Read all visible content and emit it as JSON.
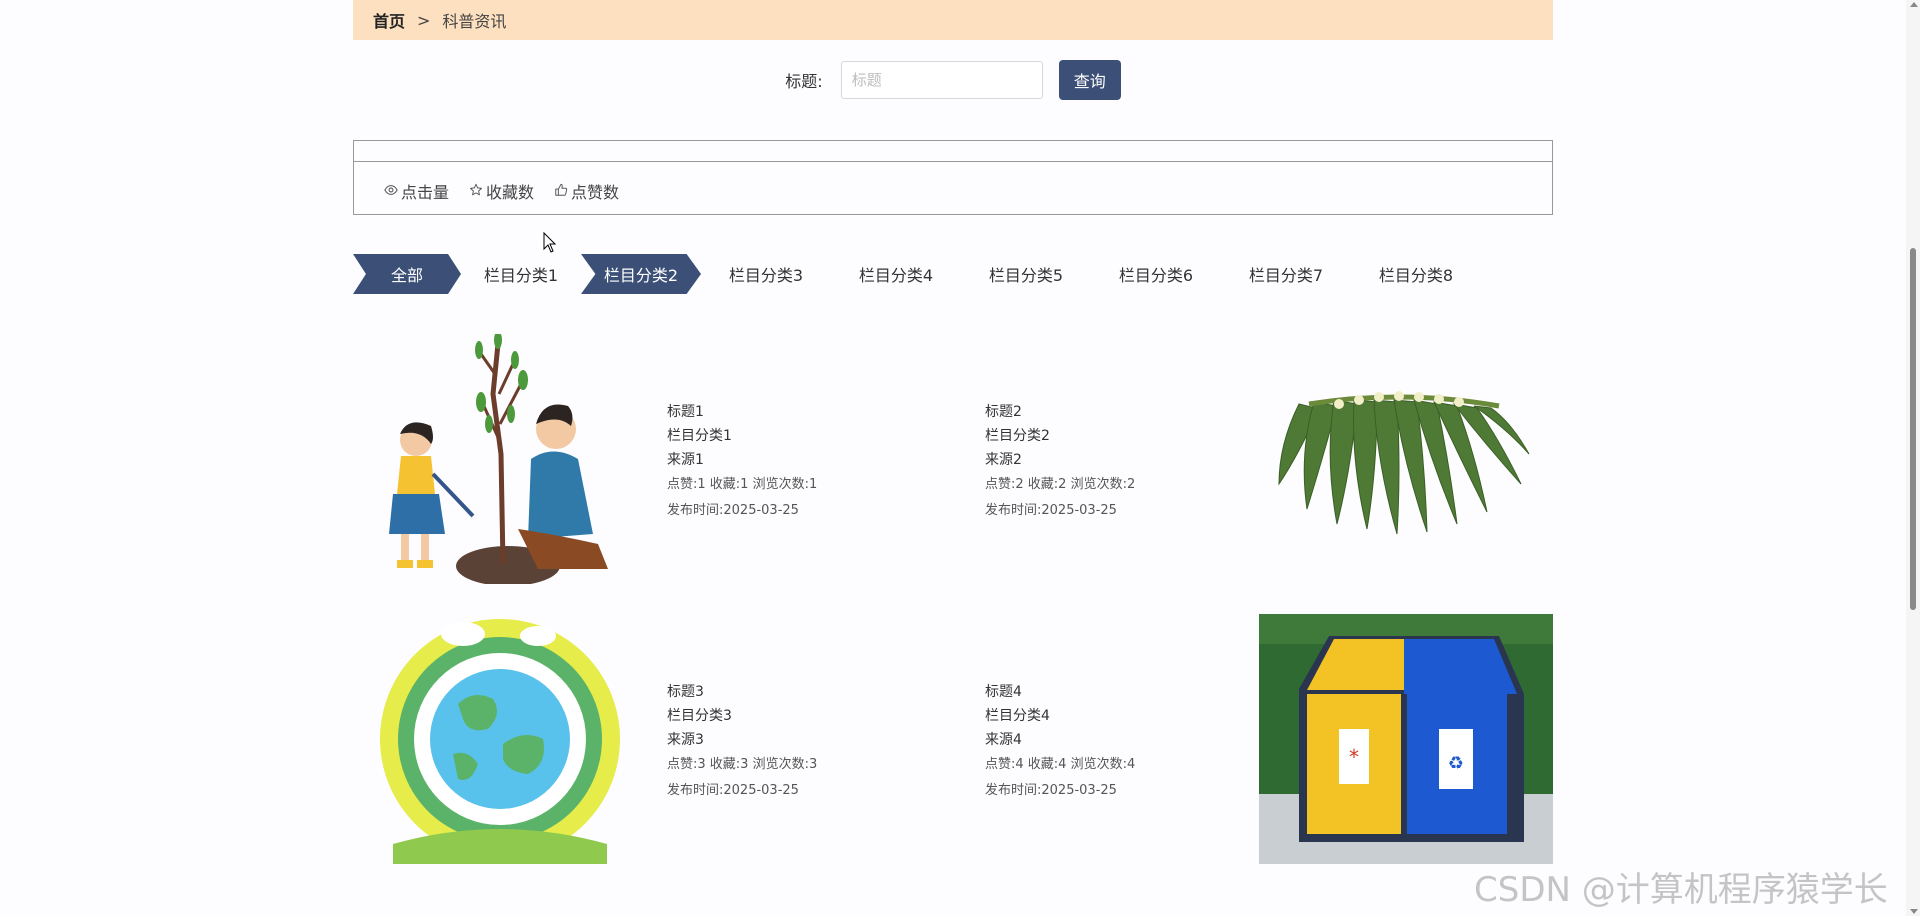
{
  "breadcrumb": {
    "home": "首页",
    "sep": ">",
    "current": "科普资讯"
  },
  "search": {
    "label": "标题:",
    "placeholder": "标题",
    "button": "查询"
  },
  "sorts": [
    "点击量",
    "收藏数",
    "点赞数"
  ],
  "tabs": [
    "全部",
    "栏目分类1",
    "栏目分类2",
    "栏目分类3",
    "栏目分类4",
    "栏目分类5",
    "栏目分类6",
    "栏目分类7",
    "栏目分类8"
  ],
  "active_tabs": [
    "全部",
    "栏目分类2"
  ],
  "articles": [
    {
      "title": "标题1",
      "category": "栏目分类1",
      "source": "来源1",
      "stats": "点赞:1  收藏:1  浏览次数:1",
      "date": "发布时间:2025-03-25",
      "image": "tree-planting-illustration"
    },
    {
      "title": "标题2",
      "category": "栏目分类2",
      "source": "来源2",
      "stats": "点赞:2  收藏:2  浏览次数:2",
      "date": "发布时间:2025-03-25",
      "image": "leaf-skirt-photo"
    },
    {
      "title": "标题3",
      "category": "栏目分类3",
      "source": "来源3",
      "stats": "点赞:3  收藏:3  浏览次数:3",
      "date": "发布时间:2025-03-25",
      "image": "earth-papercut-illustration"
    },
    {
      "title": "标题4",
      "category": "栏目分类4",
      "source": "来源4",
      "stats": "点赞:4  收藏:4  浏览次数:4",
      "date": "发布时间:2025-03-25",
      "image": "recycle-bins-photo"
    }
  ],
  "watermark": "CSDN @计算机程序猿学长",
  "colors": {
    "accent": "#3c4f77",
    "breadcrumb_bg": "#fce0c0"
  }
}
